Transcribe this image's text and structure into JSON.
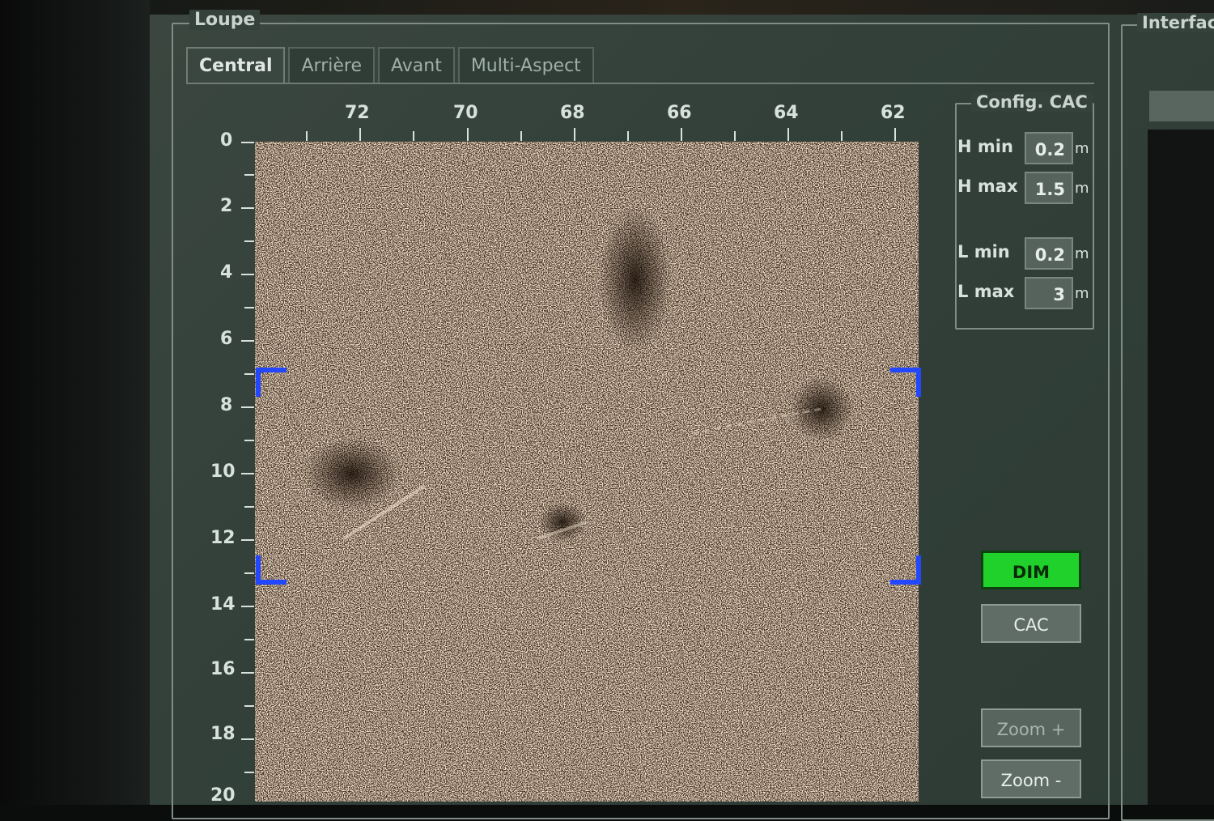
{
  "loupe": {
    "title": "Loupe",
    "tabs": [
      "Central",
      "Arrière",
      "Avant",
      "Multi-Aspect"
    ],
    "x_ticks": [
      "72",
      "70",
      "68",
      "66",
      "64",
      "62"
    ],
    "y_ticks": [
      "0",
      "2",
      "4",
      "6",
      "8",
      "10",
      "12",
      "14",
      "16",
      "18",
      "20"
    ]
  },
  "config": {
    "title": "Config. CAC",
    "h_min_label": "H min",
    "h_min_value": "0.2",
    "h_max_label": "H max",
    "h_max_value": "1.5",
    "l_min_label": "L min",
    "l_min_value": "0.2",
    "l_max_label": "L max",
    "l_max_value": "3",
    "unit": "m"
  },
  "buttons": {
    "dim": "DIM",
    "cac": "CAC",
    "zoom_in": "Zoom +",
    "zoom_out": "Zoom -"
  },
  "interface": {
    "title": "Interfac"
  },
  "colors": {
    "dim_active": "#1fd12a",
    "selection_bracket": "#2247ff"
  }
}
